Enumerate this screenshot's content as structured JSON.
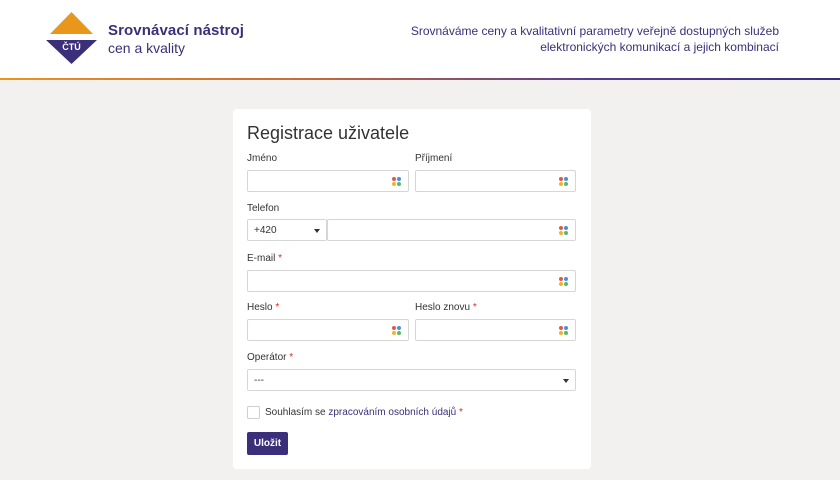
{
  "header": {
    "logo_text": "ČTÚ",
    "brand_title": "Srovnávací nástroj",
    "brand_subtitle": "cen a kvality",
    "tagline_line1": "Srovnáváme ceny a kvalitativní parametry veřejně dostupných služeb",
    "tagline_line2": "elektronických komunikací a jejich kombinací"
  },
  "form": {
    "title": "Registrace uživatele",
    "first_name_label": "Jméno",
    "last_name_label": "Příjmení",
    "phone_label": "Telefon",
    "phone_prefix": "+420",
    "email_label": "E-mail",
    "password_label": "Heslo",
    "password_again_label": "Heslo znovu",
    "operator_label": "Operátor",
    "operator_selected": "---",
    "required_mark": "*",
    "consent_prefix": "Souhlasím se ",
    "consent_link": "zpracováním osobních údajů",
    "submit_label": "Uložit"
  },
  "colors": {
    "brand": "#3b2f7a",
    "accent": "#e8961c",
    "required": "#c9302c"
  }
}
